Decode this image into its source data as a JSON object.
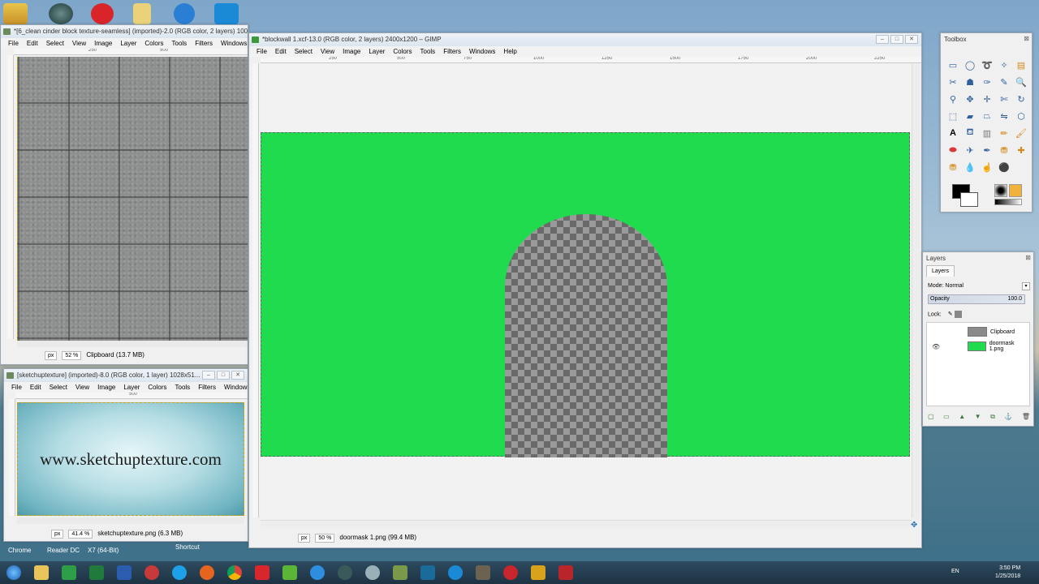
{
  "window1": {
    "title": "*[6_clean cinder block texture-seamless] (imported)-2.0 (RGB color, 2 layers) 1000x1",
    "menu": [
      "File",
      "Edit",
      "Select",
      "View",
      "Image",
      "Layer",
      "Colors",
      "Tools",
      "Filters",
      "Windows",
      "H"
    ],
    "ruler": [
      "250",
      "500"
    ],
    "unit": "px",
    "zoom": "52 %",
    "status": "Clipboard (13.7 MB)"
  },
  "window2": {
    "title": "*blockwall 1.xcf-13.0 (RGB color, 2 layers) 2400x1200 – GIMP",
    "menu": [
      "File",
      "Edit",
      "Select",
      "View",
      "Image",
      "Layer",
      "Colors",
      "Tools",
      "Filters",
      "Windows",
      "Help"
    ],
    "ruler": [
      "250",
      "500",
      "750",
      "1000",
      "1250",
      "1500",
      "1750",
      "2000",
      "2250"
    ],
    "unit": "px",
    "zoom": "50 %",
    "status": "doormask 1.png (99.4 MB)",
    "canvas_color": "#1fdb4d"
  },
  "window3": {
    "title": "[sketchuptexture] (imported)-8.0 (RGB color, 1 layer) 1028x51...",
    "menu": [
      "File",
      "Edit",
      "Select",
      "View",
      "Image",
      "Layer",
      "Colors",
      "Tools",
      "Filters",
      "Windows"
    ],
    "ruler": [
      "500"
    ],
    "image_text": "www.sketchuptexture.com",
    "unit": "px",
    "zoom": "41.4 %",
    "status": "sketchuptexture.png (6.3 MB)"
  },
  "toolbox": {
    "title": "Toolbox",
    "icons": [
      "rect-select-icon",
      "ellipse-select-icon",
      "lasso-icon",
      "fuzzy-select-icon",
      "color-select-icon",
      "scissors-icon",
      "foreground-select-icon",
      "paths-icon",
      "color-picker-icon",
      "zoom-icon",
      "measure-icon",
      "move-icon",
      "align-icon",
      "crop-icon",
      "rotate-icon",
      "scale-icon",
      "shear-icon",
      "perspective-icon",
      "flip-icon",
      "cage-icon",
      "text-icon",
      "bucket-fill-icon",
      "blend-icon",
      "pencil-icon",
      "paintbrush-icon",
      "eraser-icon",
      "airbrush-icon",
      "ink-icon",
      "clone-icon",
      "heal-icon",
      "perspective-clone-icon",
      "blur-icon",
      "smudge-icon",
      "dodge-icon"
    ],
    "fg_color": "#000000",
    "bg_color": "#ffffff"
  },
  "layers": {
    "panel_title": "Layers",
    "tab": "Layers",
    "mode_label": "Mode:",
    "mode_value": "Normal",
    "opacity_label": "Opacity",
    "opacity_value": "100.0",
    "lock_label": "Lock:",
    "items": [
      {
        "name": "Clipboard",
        "visible": false,
        "thumb": "#8a8a8a"
      },
      {
        "name": "doormask 1.png",
        "visible": true,
        "thumb": "#1fdb4d"
      }
    ]
  },
  "desktop_labels": [
    "Chrome",
    "Reader DC",
    "X7 (64-Bit)",
    "Shortcut"
  ],
  "taskbar": {
    "lang": "EN",
    "time": "3:50 PM",
    "date": "1/25/2018"
  }
}
